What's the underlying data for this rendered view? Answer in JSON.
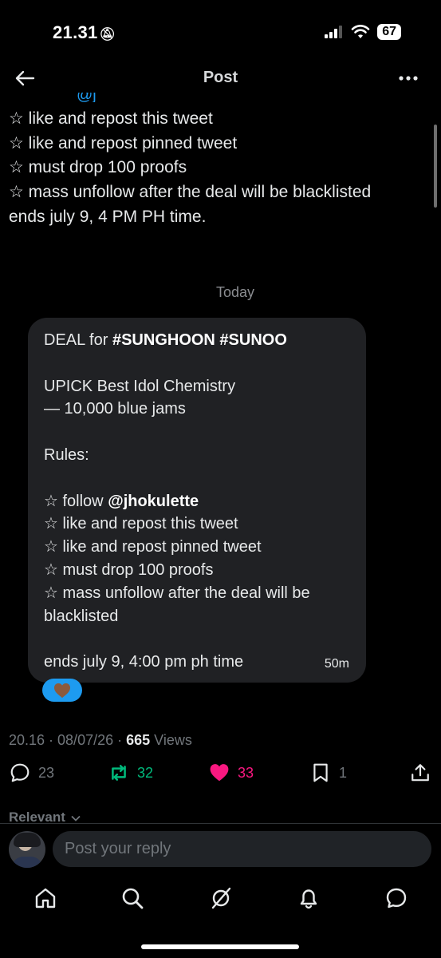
{
  "status_bar": {
    "time": "21.31",
    "battery": "67"
  },
  "header": {
    "title": "Post"
  },
  "post": {
    "cut_text": "@j",
    "lines": [
      "☆ like and repost this tweet",
      "☆ like and repost pinned tweet",
      "☆ must drop 100 proofs",
      "☆ mass unfollow after the deal will be blacklisted",
      "",
      "ends july 9, 4 PM PH time."
    ]
  },
  "date_separator": "Today",
  "message": {
    "deal_prefix": "DEAL for ",
    "deal_tags": "#SUNGHOON #SUNOO",
    "award_line": "UPICK Best Idol Chemistry",
    "amount_line": "— 10,000 blue jams",
    "rules_label": "Rules:",
    "follow_prefix": "☆ follow ",
    "follow_handle": "@jhokulette",
    "rules": [
      "☆ like and repost this tweet",
      "☆ like and repost pinned tweet",
      "☆ must drop 100 proofs",
      "☆ mass unfollow after the deal will be",
      "blacklisted"
    ],
    "ends": "ends july 9, 4:00 pm ph time",
    "time_ago": "50m",
    "reaction": "brown-heart-emoji"
  },
  "meta": {
    "timestamp": "20.16 · 08/07/26 · ",
    "views_count": "665",
    "views_label": " Views"
  },
  "actions": {
    "replies": "23",
    "reposts": "32",
    "likes": "33",
    "bookmarks": "1",
    "colors": {
      "repost": "#00ba7c",
      "like": "#f91880",
      "neutral": "#71767b"
    }
  },
  "replies_sort": "Relevant",
  "reply": {
    "placeholder": "Post your reply"
  },
  "nav": [
    "home-icon",
    "search-icon",
    "grok-icon",
    "notifications-icon",
    "messages-icon"
  ]
}
